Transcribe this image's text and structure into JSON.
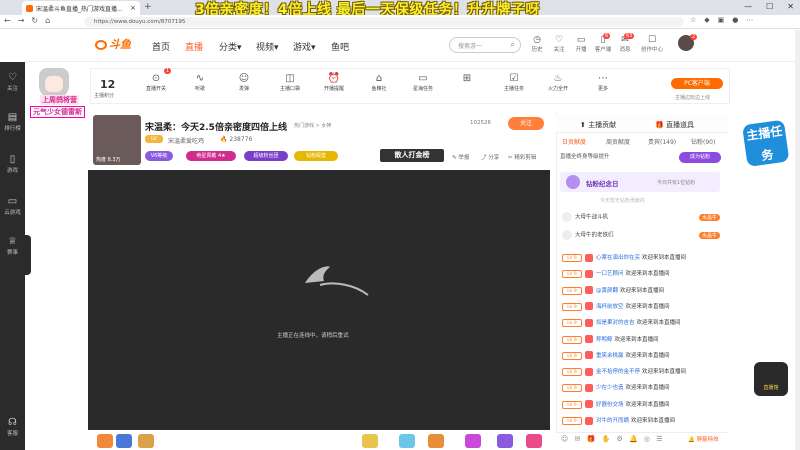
{
  "browser": {
    "tab_title": "宋温柔斗鱼直播_热门游戏直播...",
    "url": "https://www.douyu.com/8707195",
    "banner_overlay": "3倍亲密度！4倍上线 最后一天保级任务！升升牌子呀",
    "nav_back": "←",
    "nav_forward": "→",
    "nav_reload": "↻",
    "nav_home": "⌂",
    "newtab": "+",
    "win_min": "—",
    "win_max": "☐",
    "win_close": "✕"
  },
  "site": {
    "logo_text": "斗鱼",
    "nav": [
      "首页",
      "直播",
      "分类▾",
      "视频▾",
      "游戏▾",
      "鱼吧"
    ],
    "search_placeholder": "搜索游一",
    "header_icons": [
      {
        "icon": "clock-icon",
        "label": "历史"
      },
      {
        "icon": "heart-icon",
        "label": "关注"
      },
      {
        "icon": "camera-icon",
        "label": "开播"
      },
      {
        "icon": "phone-icon",
        "label": "客户端"
      },
      {
        "icon": "mail-icon",
        "label": "消息"
      },
      {
        "icon": "task-icon",
        "label": "创作中心"
      }
    ],
    "header_badge_counts": [
      "6",
      "63"
    ],
    "avatar_badge": "2"
  },
  "leftbar": [
    {
      "icon": "heart-icon",
      "label": "关注"
    },
    {
      "icon": "rank-icon",
      "label": "排行榜"
    },
    {
      "icon": "gamepad-icon",
      "label": "游戏"
    },
    {
      "icon": "cloud-game-icon",
      "label": "云游戏"
    },
    {
      "icon": "trophy-icon",
      "label": "赛事"
    },
    {
      "icon": "headset-icon",
      "label": "客服"
    }
  ],
  "toolbar": {
    "level_num": "12",
    "level_label": "主播积分",
    "items": [
      {
        "icon": "toggle-icon",
        "label": "直播开关"
      },
      {
        "icon": "wave-icon",
        "label": "听歌"
      },
      {
        "icon": "friends-icon",
        "label": "发弹"
      },
      {
        "icon": "gift-box-icon",
        "label": "主播口袋"
      },
      {
        "icon": "alarm-icon",
        "label": "开播提醒"
      },
      {
        "icon": "shop-icon",
        "label": "鱼粮社"
      },
      {
        "icon": "tv-icon",
        "label": "星海任务"
      },
      {
        "icon": "present-icon",
        "label": " "
      },
      {
        "icon": "task-icon",
        "label": "主播任务"
      },
      {
        "icon": "flame-icon",
        "label": "火力全开"
      },
      {
        "icon": "more-icon",
        "label": "更多"
      }
    ],
    "pc_button": "PC客户端",
    "pc_link": "主播边玩边上线",
    "toggle_badge": "1"
  },
  "overlay": {
    "sticker_line1": "上周鸽将营",
    "sticker_line2": "元气少女德雷斯"
  },
  "room": {
    "title": "宋温柔：今天2.5倍亲密度四倍上线",
    "category": "热门游戏 > 女神",
    "streamer_name": "宋温柔爱吃鸡",
    "level_badge": "LV",
    "fans": "🔥 238776",
    "hot": "热度 8.3万",
    "follow_count": "102526",
    "follow_button": "关注",
    "badges": [
      {
        "text": "V6等级",
        "color": "#8a5be0"
      },
      {
        "text": "绝星佩戴 4★",
        "color": "#d02c8e"
      },
      {
        "text": "超级粉丝团",
        "color": "#7c3ec8"
      },
      {
        "text": "钻粉殿堂",
        "color": "#e5b800"
      }
    ],
    "rank_tag": "散人打金榜",
    "actions": [
      "✎ 举报",
      "⤴ 分享",
      "✂ 精彩剪辑"
    ]
  },
  "video": {
    "loading_message": "主播正在连线中，请稍后重试"
  },
  "rank_panel": {
    "head_left": "⬆ 主播贡献",
    "head_right": "🎁 直播道具",
    "tabs": [
      "日贡献度",
      "周贡献度",
      "贵宾(149)",
      "钻粉(90)"
    ],
    "active_tab": 0,
    "notice": "直播全终身等级提升",
    "notice_button": "成为钻粉",
    "anniversary": "钻粉纪念日",
    "anniversary_sub": "今日共有1位钻粉",
    "empty_note": "今天暂无钻粉贡献的",
    "top": [
      {
        "rank": "1",
        "name": "大母牛战斗机",
        "tag": "水晶牛"
      },
      {
        "rank": "2",
        "name": "大母牛的老铁们",
        "tag": "水晶牛"
      }
    ]
  },
  "chat": [
    {
      "name": "心寒在演出你在买",
      "msg": "欢迎来到本直播间"
    },
    {
      "name": "一口艺顾问",
      "msg": "欢迎来到本直播间"
    },
    {
      "name": "@黄颜翻",
      "msg": "欢迎来到本直播间"
    },
    {
      "name": "海杯前放空",
      "msg": "欢迎来到本直播间"
    },
    {
      "name": "如是果对的吉吉",
      "msg": "欢迎来到本直播间"
    },
    {
      "name": "称鸭鲸",
      "msg": "欢迎来到本直播间"
    },
    {
      "name": "重笑余桃赢",
      "msg": "欢迎来到本直播间"
    },
    {
      "name": "金不拾停的金不停",
      "msg": "欢迎来到本直播间"
    },
    {
      "name": "少在少也造",
      "msg": "欢迎来到本直播间"
    },
    {
      "name": "好器份交场",
      "msg": "欢迎来到本直播间"
    },
    {
      "name": "对牛的开而嫡",
      "msg": "欢迎来到本直播间"
    }
  ],
  "chat_level": "LV 9",
  "chat_bottom": {
    "icons": "☺ ✉ 🎁 ✋ ⚙ 🔔 ◎ ☰",
    "right": "🔔 屏蔽特效"
  },
  "right_stickers": {
    "top": "主播任务",
    "bottom": "直播馆"
  }
}
